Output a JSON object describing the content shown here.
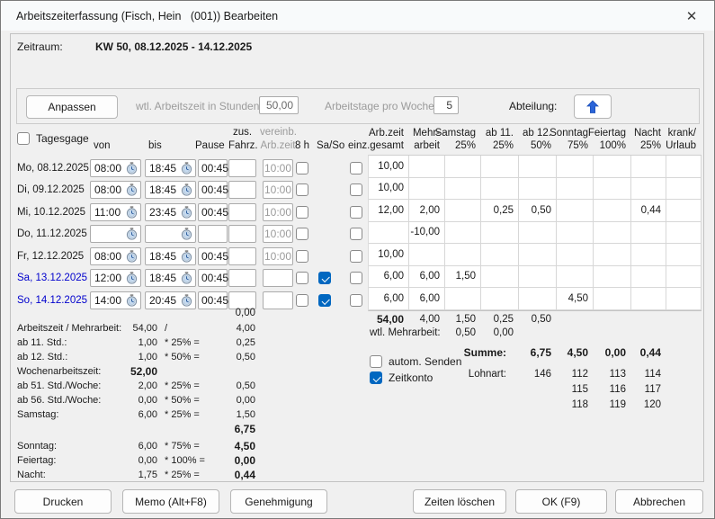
{
  "window": {
    "title": "Arbeitszeiterfassung (Fisch, Hein   (001)) Bearbeiten"
  },
  "icons": {
    "close": "✕"
  },
  "period": {
    "label": "Zeitraum:",
    "value": "KW 50, 08.12.2025 - 14.12.2025"
  },
  "settings": {
    "adjust_button": "Anpassen",
    "weekly_hours_label": "wtl. Arbeitszeit in Stunden:",
    "weekly_hours_value": "50,00",
    "workdays_label": "Arbeitstage pro Woche:",
    "workdays_value": "5",
    "department_label": "Abteilung:"
  },
  "grid": {
    "tagesgage_label": "Tagesgage",
    "tagesgage_checked": "false",
    "headers": {
      "von": "von",
      "bis": "bis",
      "pause": "Pause",
      "fahrz1": "zus.",
      "fahrz2": "Fahrz.",
      "vereinb1": "vereinb.",
      "vereinb2": "Arb.zeit",
      "h8": "8 h",
      "saso": "Sa/So",
      "einz": "einz."
    },
    "table_headers": [
      {
        "l1": "Arb.zeit",
        "l2": "gesamt"
      },
      {
        "l1": "Mehr-",
        "l2": "arbeit"
      },
      {
        "l1": "Samstag",
        "l2": "25%"
      },
      {
        "l1": "ab 11.",
        "l2": "25%"
      },
      {
        "l1": "ab 12.",
        "l2": "50%"
      },
      {
        "l1": "Sonntag",
        "l2": "75%"
      },
      {
        "l1": "Feiertag",
        "l2": "100%"
      },
      {
        "l1": "Nacht",
        "l2": "25%"
      },
      {
        "l1": "krank/",
        "l2": "Urlaub"
      }
    ],
    "rows": [
      {
        "day": "Mo, 08.12.2025",
        "von": "08:00",
        "bis": "18:45",
        "pause": "00:45",
        "fahrz": "",
        "vereinb": "10:00",
        "h8": "false",
        "einz": "false",
        "cells": [
          "10,00",
          "",
          "",
          "",
          "",
          "",
          "",
          "",
          ""
        ]
      },
      {
        "day": "Di, 09.12.2025",
        "von": "08:00",
        "bis": "18:45",
        "pause": "00:45",
        "fahrz": "",
        "vereinb": "10:00",
        "h8": "false",
        "einz": "false",
        "cells": [
          "10,00",
          "",
          "",
          "",
          "",
          "",
          "",
          "",
          ""
        ]
      },
      {
        "day": "Mi, 10.12.2025",
        "von": "11:00",
        "bis": "23:45",
        "pause": "00:45",
        "fahrz": "",
        "vereinb": "10:00",
        "h8": "false",
        "einz": "false",
        "cells": [
          "12,00",
          "2,00",
          "",
          "0,25",
          "0,50",
          "",
          "",
          "0,44",
          ""
        ]
      },
      {
        "day": "Do, 11.12.2025",
        "von": "",
        "bis": "",
        "pause": "",
        "fahrz": "",
        "vereinb": "10:00",
        "h8": "false",
        "einz": "false",
        "cells": [
          "",
          "-10,00",
          "",
          "",
          "",
          "",
          "",
          "",
          ""
        ]
      },
      {
        "day": "Fr, 12.12.2025",
        "von": "08:00",
        "bis": "18:45",
        "pause": "00:45",
        "fahrz": "",
        "vereinb": "10:00",
        "h8": "false",
        "einz": "false",
        "cells": [
          "10,00",
          "",
          "",
          "",
          "",
          "",
          "",
          "",
          ""
        ]
      },
      {
        "day": "Sa, 13.12.2025",
        "von": "12:00",
        "bis": "18:45",
        "pause": "00:45",
        "fahrz": "",
        "vereinb": "",
        "h8": "false",
        "saso": "true",
        "einz": "false",
        "cells": [
          "6,00",
          "6,00",
          "1,50",
          "",
          "",
          "",
          "",
          "",
          ""
        ]
      },
      {
        "day": "So, 14.12.2025",
        "von": "14:00",
        "bis": "20:45",
        "pause": "00:45",
        "fahrz": "",
        "vereinb": "",
        "h8": "false",
        "saso": "true",
        "einz": "false",
        "cells": [
          "6,00",
          "6,00",
          "",
          "",
          "",
          "4,50",
          "",
          "",
          ""
        ]
      }
    ],
    "fahrz_total": "0,00",
    "totals": [
      "54,00",
      "4,00",
      "1,50",
      "0,25",
      "0,50",
      "",
      "",
      "",
      ""
    ],
    "wtl_mehrarbeit_label": "wtl. Mehrarbeit:",
    "wtl_mehrarbeit": [
      "0,50",
      "0,00"
    ]
  },
  "summary_left": {
    "rows": [
      {
        "label": "Arbeitszeit / Mehrarbeit:",
        "value": "54,00",
        "op": "/",
        "result": "4,00"
      },
      {
        "label": "ab 11. Std.:",
        "value": "1,00",
        "op": "* 25% =",
        "result": "0,25"
      },
      {
        "label": "ab 12. Std.:",
        "value": "1,00",
        "op": "* 50% =",
        "result": "0,50"
      },
      {
        "label": "Wochenarbeitszeit:",
        "value": "52,00",
        "op": "",
        "result": ""
      },
      {
        "label": "ab 51. Std./Woche:",
        "value": "2,00",
        "op": "* 25% =",
        "result": "0,50"
      },
      {
        "label": "ab 56. Std./Woche:",
        "value": "0,00",
        "op": "* 50% =",
        "result": "0,00"
      },
      {
        "label": "Samstag:",
        "value": "6,00",
        "op": "* 25% =",
        "result": "1,50"
      },
      {
        "label": "",
        "value": "",
        "op": "",
        "result": "6,75"
      },
      {
        "label": "Sonntag:",
        "value": "6,00",
        "op": "* 75% =",
        "result": "4,50"
      },
      {
        "label": "Feiertag:",
        "value": "0,00",
        "op": "* 100% =",
        "result": "0,00"
      },
      {
        "label": "Nacht:",
        "value": "1,75",
        "op": "* 25% =",
        "result": "0,44"
      }
    ]
  },
  "summary_right": {
    "autosend_label": "autom. Senden",
    "autosend_checked": "false",
    "zeitkonto_label": "Zeitkonto",
    "zeitkonto_checked": "true",
    "summe_label": "Summe:",
    "summe_values": [
      "6,75",
      "4,50",
      "0,00",
      "0,44"
    ],
    "lohnart_label": "Lohnart:",
    "lohnart_rows": [
      [
        "146",
        "112",
        "113",
        "114"
      ],
      [
        "",
        "115",
        "116",
        "117"
      ],
      [
        "",
        "118",
        "119",
        "120"
      ]
    ]
  },
  "buttons": {
    "drucken": "Drucken",
    "memo": "Memo (Alt+F8)",
    "genehmigung": "Genehmigung",
    "zeiten_loeschen": "Zeiten löschen",
    "ok": "OK (F9)",
    "abbrechen": "Abbrechen"
  }
}
